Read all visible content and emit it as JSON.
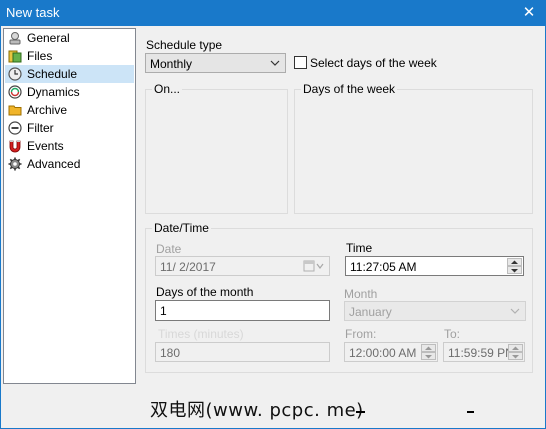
{
  "window": {
    "title": "New task",
    "close_glyph": "✕"
  },
  "sidebar": {
    "items": [
      {
        "label": "General",
        "icon": "general-icon"
      },
      {
        "label": "Files",
        "icon": "files-icon"
      },
      {
        "label": "Schedule",
        "icon": "clock-icon",
        "selected": true
      },
      {
        "label": "Dynamics",
        "icon": "dynamics-icon"
      },
      {
        "label": "Archive",
        "icon": "archive-icon"
      },
      {
        "label": "Filter",
        "icon": "filter-icon"
      },
      {
        "label": "Events",
        "icon": "magnet-icon"
      },
      {
        "label": "Advanced",
        "icon": "gear-icon"
      }
    ]
  },
  "schedule": {
    "type_label": "Schedule type",
    "type_value": "Monthly",
    "select_days_label": "Select days of the week",
    "select_days_checked": false,
    "on_group_label": "On...",
    "days_group_label": "Days of the week"
  },
  "datetime": {
    "group_label": "Date/Time",
    "date_label": "Date",
    "date_value": "11/  2/2017",
    "time_label": "Time",
    "time_value": "11:27:05 AM",
    "days_of_month_label": "Days of the month",
    "days_of_month_value": "1",
    "month_label": "Month",
    "month_value": "January",
    "times_label": "Times (minutes)",
    "times_value": "180",
    "from_label": "From:",
    "from_value": "12:00:00 AM",
    "to_label": "To:",
    "to_value": "11:59:59 PN"
  },
  "watermark": {
    "text": "双电网(www. pcpc. me)"
  },
  "colors": {
    "titlebar": "#1979ca",
    "selected_item": "#cce4f7"
  }
}
